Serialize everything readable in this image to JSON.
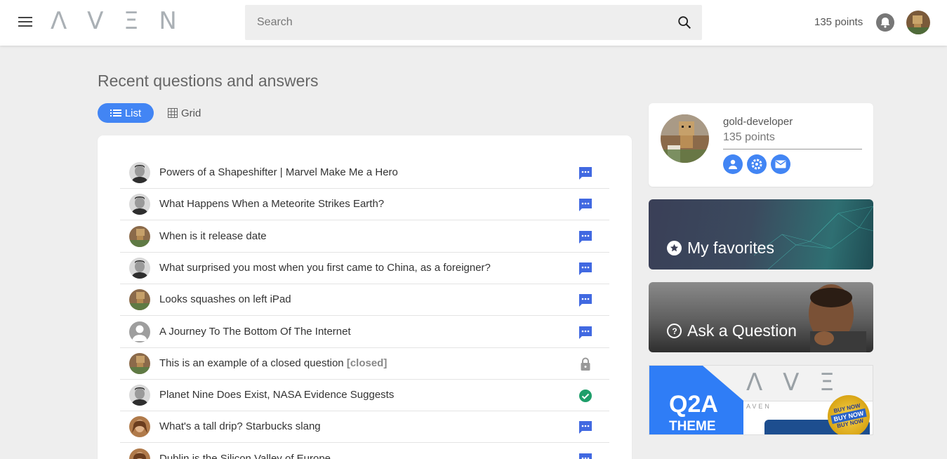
{
  "header": {
    "logo": "Λ V Ξ N",
    "search_placeholder": "Search",
    "points": "135 points"
  },
  "main": {
    "title": "Recent questions and answers",
    "view_list_label": "List",
    "view_grid_label": "Grid",
    "questions": [
      {
        "title": "Powers of a Shapeshifter | Marvel Make Me a Hero",
        "avatar": "man-portrait",
        "status": "answer-icon"
      },
      {
        "title": "What Happens When a Meteorite Strikes Earth?",
        "avatar": "man-portrait",
        "status": "answer-icon"
      },
      {
        "title": "When is it release date",
        "avatar": "robot-toy",
        "status": "answer-icon"
      },
      {
        "title": "What surprised you most when you first came to China, as a foreigner?",
        "avatar": "man-portrait",
        "status": "answer-icon"
      },
      {
        "title": "Looks squashes on left iPad",
        "avatar": "robot-toy",
        "status": "answer-icon"
      },
      {
        "title": "A Journey To The Bottom Of The Internet",
        "avatar": "default-user",
        "status": "answer-icon"
      },
      {
        "title": "This is an example of a closed question",
        "closed_tag": "[closed]",
        "avatar": "robot-toy",
        "status": "lock-icon"
      },
      {
        "title": "Planet Nine Does Exist, NASA Evidence Suggests",
        "avatar": "man-portrait",
        "status": "check-icon"
      },
      {
        "title": "What's a tall drip? Starbucks slang",
        "avatar": "woman-portrait",
        "status": "answer-icon"
      },
      {
        "title": "Dublin is the Silicon Valley of Europe",
        "avatar": "woman-portrait",
        "status": "answer-icon"
      }
    ]
  },
  "sidebar": {
    "username": "gold-developer",
    "points": "135 points",
    "favorites_label": "My favorites",
    "ask_label": "Ask a Question",
    "banner": {
      "logo": "Λ V Ξ N",
      "q2a": "Q2A",
      "theme": "THEME",
      "mock_logo": "AVEN",
      "badge_top": "BUY NOW",
      "badge_mid": "BUY NOW",
      "badge_bot": "BUY NOW"
    }
  },
  "colors": {
    "accent": "#4285f4",
    "answered": "#1e9e6a",
    "closed": "#999999"
  }
}
